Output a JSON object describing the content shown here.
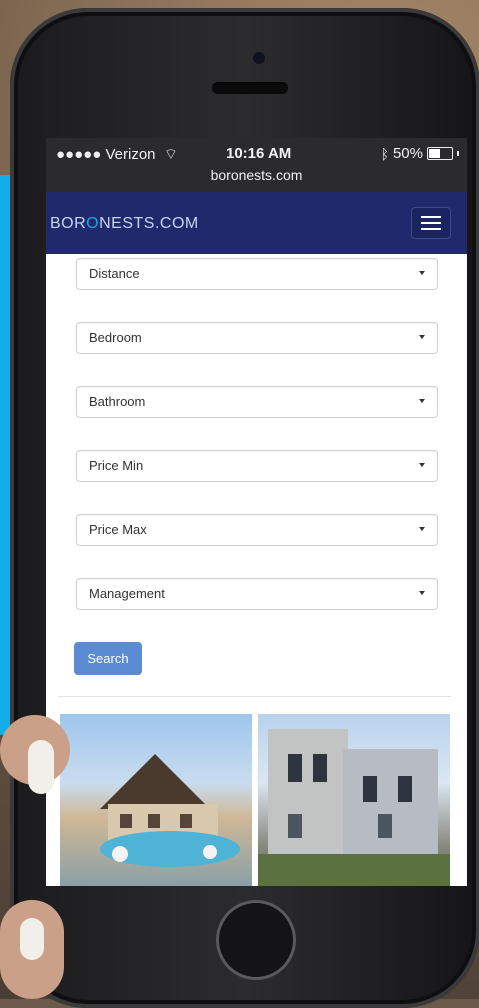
{
  "status_bar": {
    "carrier": "●●●●● Verizon",
    "time": "10:16 AM",
    "battery": "50%",
    "battery_level": 0.5,
    "url": "boronests.com"
  },
  "navbar": {
    "brand_prefix": "BOR",
    "brand_o": "O",
    "brand_suffix": "NESTS.COM",
    "menu_icon": "hamburger-menu-icon"
  },
  "filters": [
    {
      "label": "Distance"
    },
    {
      "label": "Bedroom"
    },
    {
      "label": "Bathroom"
    },
    {
      "label": "Price Min"
    },
    {
      "label": "Price Max"
    },
    {
      "label": "Management"
    }
  ],
  "search_label": "Search",
  "colors": {
    "navbar": "#1e2a6b",
    "button": "#5a8bd3",
    "accent": "#1fa5e3"
  },
  "icons": [
    "wifi-icon",
    "bluetooth-icon",
    "battery-icon",
    "hamburger-menu-icon",
    "caret-down-icon"
  ]
}
